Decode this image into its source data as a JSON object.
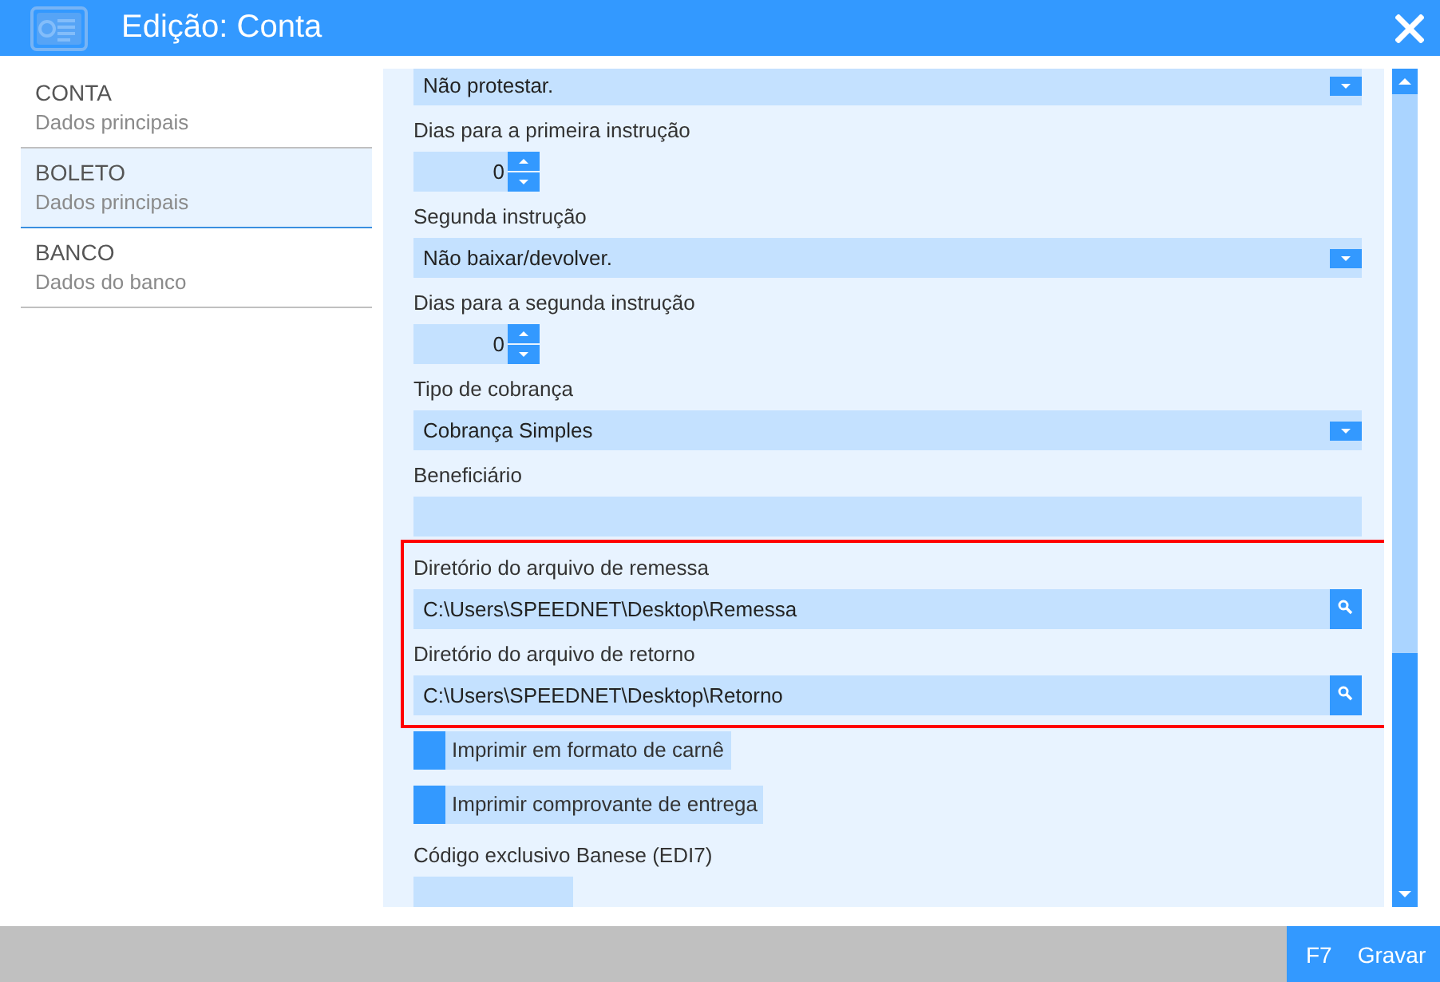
{
  "window": {
    "title": "Edição: Conta"
  },
  "sidebar": {
    "items": [
      {
        "title": "CONTA",
        "subtitle": "Dados principais",
        "selected": false
      },
      {
        "title": "BOLETO",
        "subtitle": "Dados principais",
        "selected": true
      },
      {
        "title": "BANCO",
        "subtitle": "Dados do banco",
        "selected": false
      }
    ]
  },
  "form": {
    "fields": [
      {
        "kind": "select",
        "value": "Não protestar."
      },
      {
        "kind": "spinner",
        "label": "Dias para a primeira instrução",
        "value": "0"
      },
      {
        "kind": "select",
        "label": "Segunda instrução",
        "value": "Não baixar/devolver."
      },
      {
        "kind": "spinner",
        "label": "Dias para a segunda instrução",
        "value": "0"
      },
      {
        "kind": "select",
        "label": "Tipo de cobrança",
        "value": "Cobrança Simples"
      },
      {
        "kind": "text",
        "label": "Beneficiário"
      },
      {
        "kind": "highlight-group",
        "fields": [
          {
            "kind": "path",
            "label": "Diretório do arquivo de remessa",
            "value": "C:\\Users\\SPEEDNET\\Desktop\\Remessa"
          },
          {
            "kind": "path",
            "label": "Diretório do arquivo de retorno",
            "value": "C:\\Users\\SPEEDNET\\Desktop\\Retorno"
          }
        ]
      },
      {
        "kind": "checkbox",
        "label": "Imprimir em formato de carnê",
        "checked": false
      },
      {
        "kind": "checkbox",
        "label": "Imprimir comprovante de entrega",
        "checked": false
      },
      {
        "kind": "short-text",
        "label": "Código exclusivo Banese (EDI7)"
      }
    ]
  },
  "footer": {
    "button": {
      "key": "F7",
      "label": "Gravar"
    }
  }
}
